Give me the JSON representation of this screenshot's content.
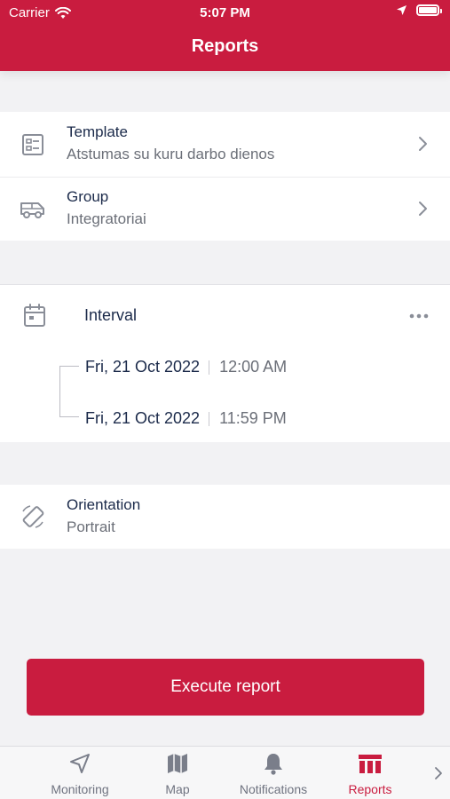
{
  "status": {
    "carrier": "Carrier",
    "time": "5:07 PM"
  },
  "header": {
    "title": "Reports"
  },
  "settings": {
    "template": {
      "label": "Template",
      "value": "Atstumas su kuru darbo dienos"
    },
    "group": {
      "label": "Group",
      "value": "Integratoriai"
    }
  },
  "interval": {
    "label": "Interval",
    "from": {
      "date": "Fri, 21 Oct 2022",
      "time": "12:00 AM"
    },
    "to": {
      "date": "Fri, 21 Oct 2022",
      "time": "11:59 PM"
    }
  },
  "orientation": {
    "label": "Orientation",
    "value": "Portrait"
  },
  "actions": {
    "execute": "Execute report"
  },
  "tabs": [
    {
      "label": "Monitoring",
      "icon": "navigation-arrow-icon"
    },
    {
      "label": "Map",
      "icon": "map-icon"
    },
    {
      "label": "Notifications",
      "icon": "bell-icon"
    },
    {
      "label": "Reports",
      "icon": "reports-table-icon",
      "active": true
    }
  ],
  "colors": {
    "brand": "#c91c3f",
    "text": "#1b2a4a",
    "muted": "#6b6f78"
  }
}
